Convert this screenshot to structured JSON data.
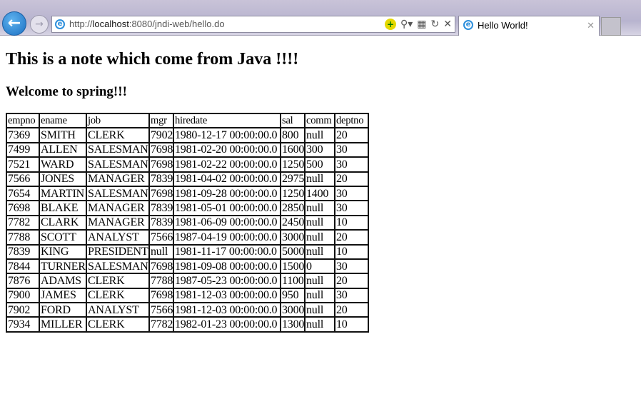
{
  "browser": {
    "url_prefix": "http://",
    "url_host": "localhost",
    "url_rest": ":8080/jndi-web/hello.do",
    "tab_title": "Hello World!"
  },
  "page": {
    "heading": "This is a note which come from Java !!!!",
    "subheading": "Welcome to spring!!!"
  },
  "table": {
    "columns": [
      "empno",
      "ename",
      "job",
      "mgr",
      "hiredate",
      "sal",
      "comm",
      "deptno"
    ],
    "rows": [
      [
        "7369",
        "SMITH",
        "CLERK",
        "7902",
        "1980-12-17 00:00:00.0",
        "800",
        "null",
        "20"
      ],
      [
        "7499",
        "ALLEN",
        "SALESMAN",
        "7698",
        "1981-02-20 00:00:00.0",
        "1600",
        "300",
        "30"
      ],
      [
        "7521",
        "WARD",
        "SALESMAN",
        "7698",
        "1981-02-22 00:00:00.0",
        "1250",
        "500",
        "30"
      ],
      [
        "7566",
        "JONES",
        "MANAGER",
        "7839",
        "1981-04-02 00:00:00.0",
        "2975",
        "null",
        "20"
      ],
      [
        "7654",
        "MARTIN",
        "SALESMAN",
        "7698",
        "1981-09-28 00:00:00.0",
        "1250",
        "1400",
        "30"
      ],
      [
        "7698",
        "BLAKE",
        "MANAGER",
        "7839",
        "1981-05-01 00:00:00.0",
        "2850",
        "null",
        "30"
      ],
      [
        "7782",
        "CLARK",
        "MANAGER",
        "7839",
        "1981-06-09 00:00:00.0",
        "2450",
        "null",
        "10"
      ],
      [
        "7788",
        "SCOTT",
        "ANALYST",
        "7566",
        "1987-04-19 00:00:00.0",
        "3000",
        "null",
        "20"
      ],
      [
        "7839",
        "KING",
        "PRESIDENT",
        "null",
        "1981-11-17 00:00:00.0",
        "5000",
        "null",
        "10"
      ],
      [
        "7844",
        "TURNER",
        "SALESMAN",
        "7698",
        "1981-09-08 00:00:00.0",
        "1500",
        "0",
        "30"
      ],
      [
        "7876",
        "ADAMS",
        "CLERK",
        "7788",
        "1987-05-23 00:00:00.0",
        "1100",
        "null",
        "20"
      ],
      [
        "7900",
        "JAMES",
        "CLERK",
        "7698",
        "1981-12-03 00:00:00.0",
        "950",
        "null",
        "30"
      ],
      [
        "7902",
        "FORD",
        "ANALYST",
        "7566",
        "1981-12-03 00:00:00.0",
        "3000",
        "null",
        "20"
      ],
      [
        "7934",
        "MILLER",
        "CLERK",
        "7782",
        "1982-01-23 00:00:00.0",
        "1300",
        "null",
        "10"
      ]
    ]
  }
}
